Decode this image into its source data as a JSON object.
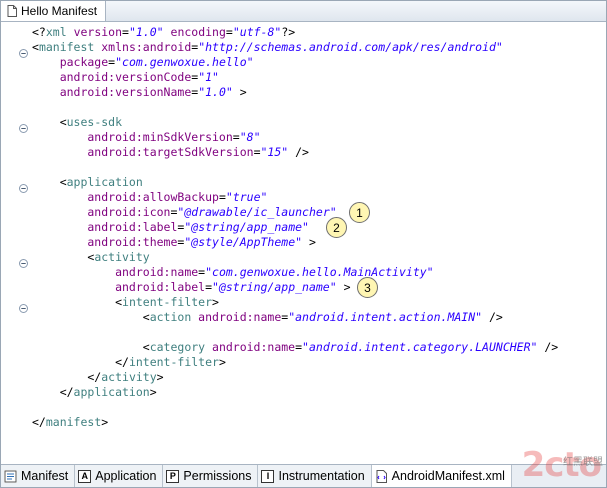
{
  "window": {
    "title": "Hello Manifest"
  },
  "code_lines": [
    [
      [
        "p",
        "<?"
      ],
      [
        "t",
        "xml"
      ],
      [
        "a",
        " version"
      ],
      [
        "p",
        "="
      ],
      [
        "v",
        "\"1.0\""
      ],
      [
        "a",
        " encoding"
      ],
      [
        "p",
        "="
      ],
      [
        "v",
        "\"utf-8\""
      ],
      [
        "p",
        "?>"
      ]
    ],
    [
      [
        "p",
        "<"
      ],
      [
        "t",
        "manifest"
      ],
      [
        "a",
        " xmlns:android"
      ],
      [
        "p",
        "="
      ],
      [
        "v",
        "\"http://schemas.android.com/apk/res/android\""
      ]
    ],
    [
      [
        "a",
        "    package"
      ],
      [
        "p",
        "="
      ],
      [
        "v",
        "\"com.genwoxue.hello\""
      ]
    ],
    [
      [
        "a",
        "    android:versionCode"
      ],
      [
        "p",
        "="
      ],
      [
        "v",
        "\"1\""
      ]
    ],
    [
      [
        "a",
        "    android:versionName"
      ],
      [
        "p",
        "="
      ],
      [
        "v",
        "\"1.0\""
      ],
      [
        "p",
        " >"
      ]
    ],
    [],
    [
      [
        "p",
        "    <"
      ],
      [
        "t",
        "uses-sdk"
      ]
    ],
    [
      [
        "a",
        "        android:minSdkVersion"
      ],
      [
        "p",
        "="
      ],
      [
        "v",
        "\"8\""
      ]
    ],
    [
      [
        "a",
        "        android:targetSdkVersion"
      ],
      [
        "p",
        "="
      ],
      [
        "v",
        "\"15\""
      ],
      [
        "p",
        " />"
      ]
    ],
    [],
    [
      [
        "p",
        "    <"
      ],
      [
        "t",
        "application"
      ]
    ],
    [
      [
        "a",
        "        android:allowBackup"
      ],
      [
        "p",
        "="
      ],
      [
        "v",
        "\"true\""
      ]
    ],
    [
      [
        "a",
        "        android:icon"
      ],
      [
        "p",
        "="
      ],
      [
        "v",
        "\"@drawable/ic_launcher\""
      ]
    ],
    [
      [
        "a",
        "        android:label"
      ],
      [
        "p",
        "="
      ],
      [
        "v",
        "\"@string/app_name\""
      ]
    ],
    [
      [
        "a",
        "        android:theme"
      ],
      [
        "p",
        "="
      ],
      [
        "v",
        "\"@style/AppTheme\""
      ],
      [
        "p",
        " >"
      ]
    ],
    [
      [
        "p",
        "        <"
      ],
      [
        "t",
        "activity"
      ]
    ],
    [
      [
        "a",
        "            android:name"
      ],
      [
        "p",
        "="
      ],
      [
        "v",
        "\"com.genwoxue.hello.MainActivity\""
      ]
    ],
    [
      [
        "a",
        "            android:label"
      ],
      [
        "p",
        "="
      ],
      [
        "v",
        "\"@string/app_name\""
      ],
      [
        "p",
        " >"
      ]
    ],
    [
      [
        "p",
        "            <"
      ],
      [
        "t",
        "intent-filter"
      ],
      [
        "p",
        ">"
      ]
    ],
    [
      [
        "p",
        "                <"
      ],
      [
        "t",
        "action"
      ],
      [
        "a",
        " android:name"
      ],
      [
        "p",
        "="
      ],
      [
        "v",
        "\"android.intent.action.MAIN\""
      ],
      [
        "p",
        " />"
      ]
    ],
    [],
    [
      [
        "p",
        "                <"
      ],
      [
        "t",
        "category"
      ],
      [
        "a",
        " android:name"
      ],
      [
        "p",
        "="
      ],
      [
        "v",
        "\"android.intent.category.LAUNCHER\""
      ],
      [
        "p",
        " />"
      ]
    ],
    [
      [
        "p",
        "            </"
      ],
      [
        "t",
        "intent-filter"
      ],
      [
        "p",
        ">"
      ]
    ],
    [
      [
        "p",
        "        </"
      ],
      [
        "t",
        "activity"
      ],
      [
        "p",
        ">"
      ]
    ],
    [
      [
        "p",
        "    </"
      ],
      [
        "t",
        "application"
      ],
      [
        "p",
        ">"
      ]
    ],
    [],
    [
      [
        "p",
        "</"
      ],
      [
        "t",
        "manifest"
      ],
      [
        "p",
        ">"
      ]
    ]
  ],
  "callouts": [
    {
      "label": "1",
      "line": 12
    },
    {
      "label": "2",
      "line": 13
    },
    {
      "label": "3",
      "line": 17
    }
  ],
  "fold_lines": [
    1,
    6,
    10,
    15,
    18
  ],
  "bottom_tabs": [
    {
      "label": "Manifest",
      "icon": "manifest-icon",
      "glyph": "",
      "active": false
    },
    {
      "label": "Application",
      "icon": "application-icon",
      "glyph": "A",
      "active": false
    },
    {
      "label": "Permissions",
      "icon": "permissions-icon",
      "glyph": "P",
      "active": false
    },
    {
      "label": "Instrumentation",
      "icon": "instrumentation-icon",
      "glyph": "I",
      "active": false
    },
    {
      "label": "AndroidManifest.xml",
      "icon": "xml-file-icon",
      "glyph": "",
      "active": true
    }
  ],
  "watermark": {
    "text": "2cto",
    "sub": "红黑联盟"
  },
  "colors": {
    "tag": "#3f7f7f",
    "attribute": "#7f007f",
    "value": "#2a00ff",
    "callout_fill": "#fff6b3"
  }
}
